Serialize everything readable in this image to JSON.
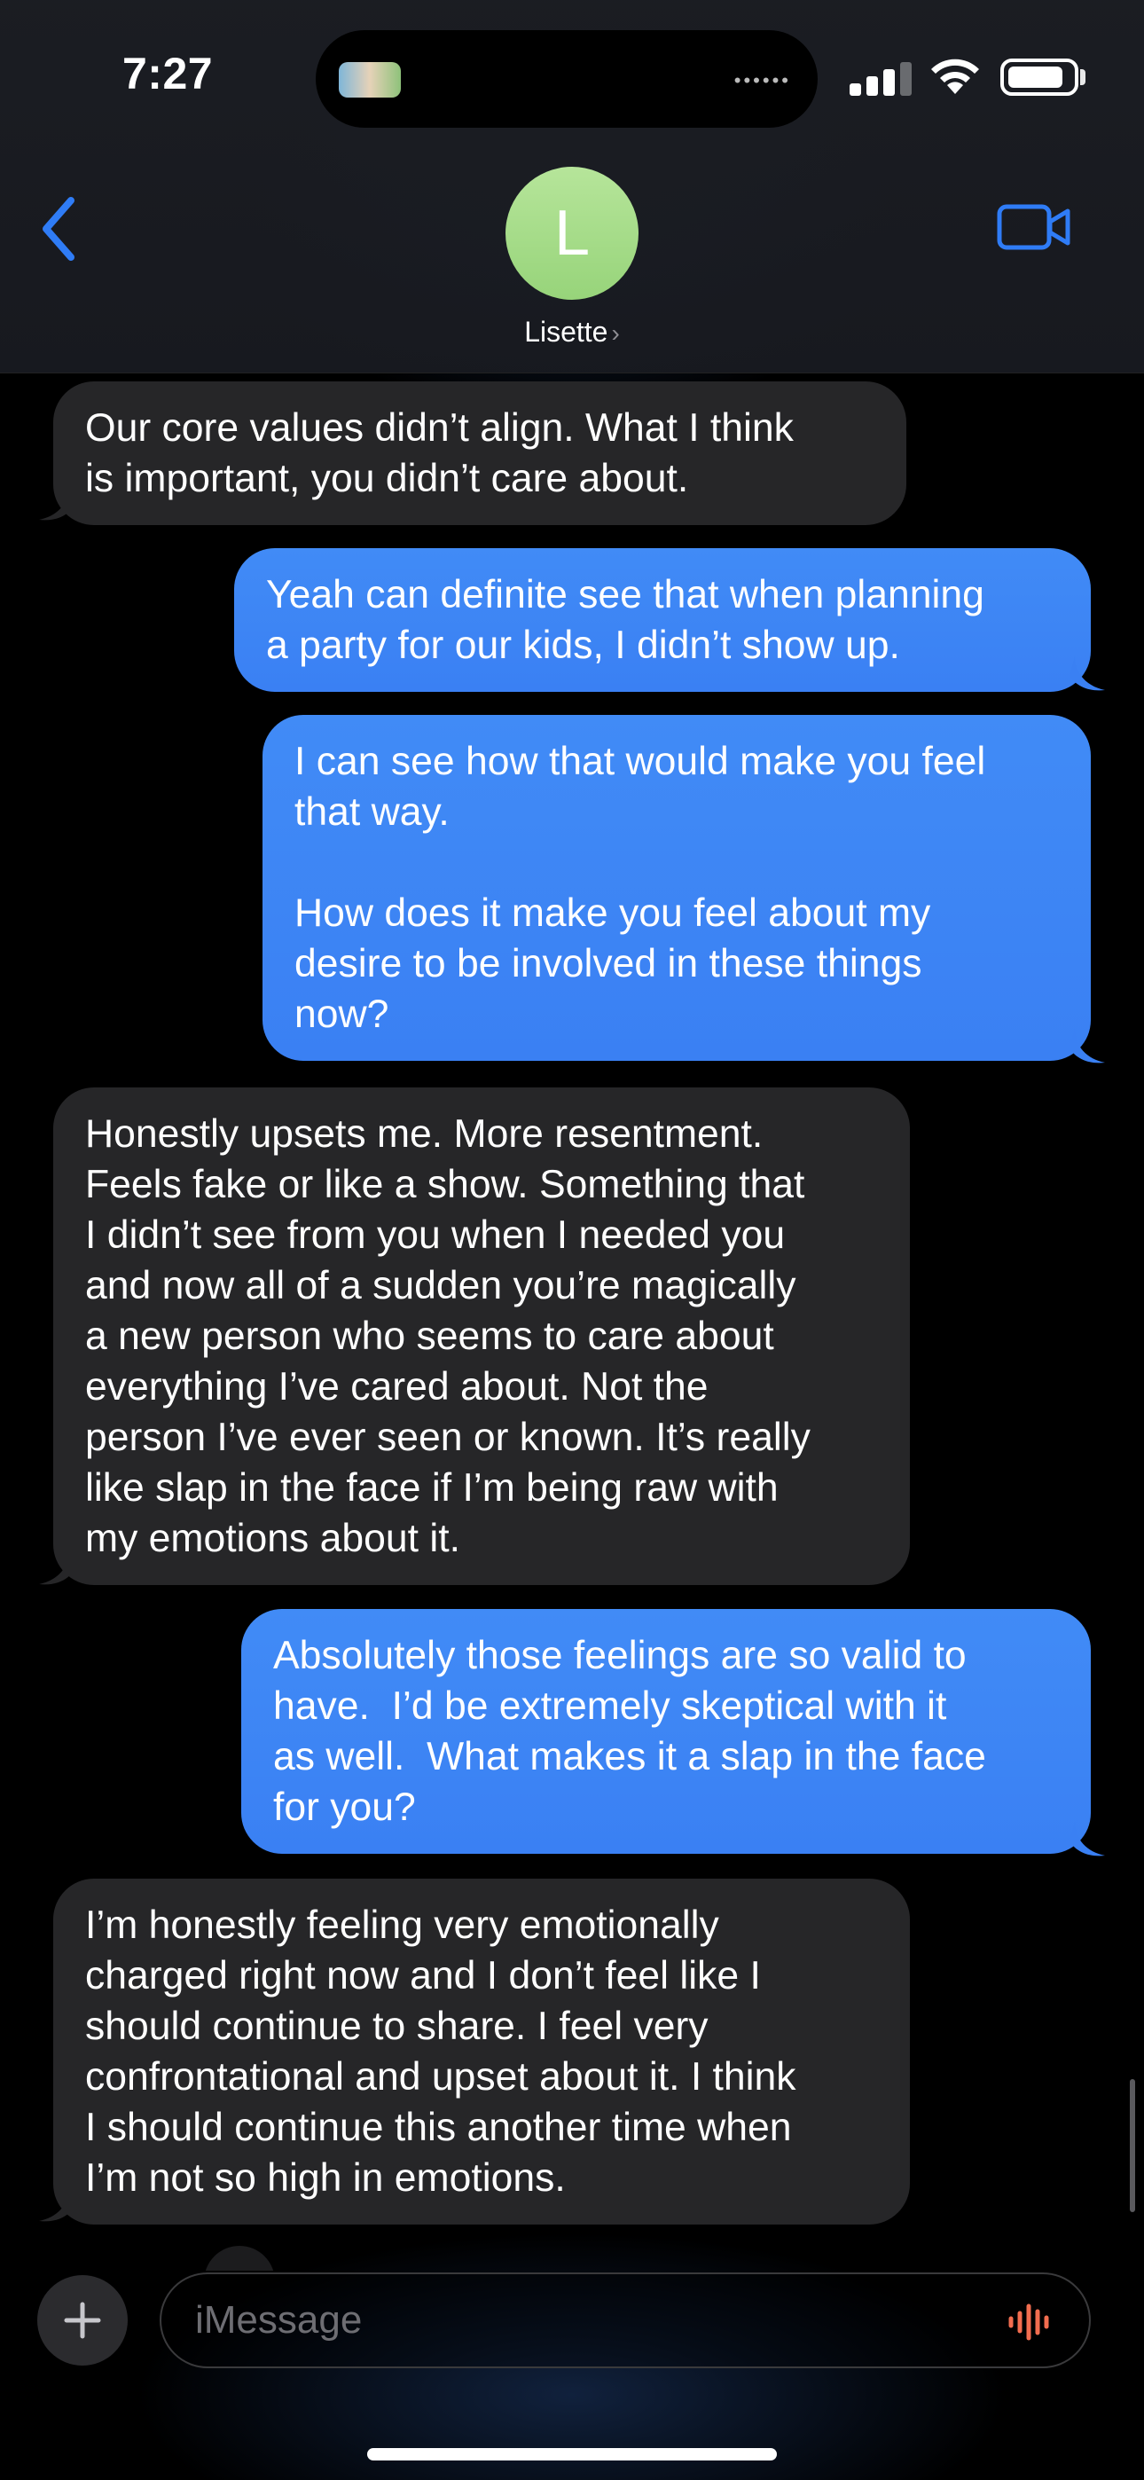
{
  "status_bar": {
    "time": "7:27"
  },
  "header": {
    "contact_name": "Lisette",
    "avatar_initial": "L"
  },
  "messages": [
    {
      "direction": "received",
      "text": "Our core values didn’t align. What I think\nis important, you didn’t care about."
    },
    {
      "direction": "sent",
      "text": "Yeah can definite see that when planning\na party for our kids, I didn’t show up."
    },
    {
      "direction": "sent",
      "text": "I can see how that would make you feel\nthat way.\n\nHow does it make you feel about my\ndesire to be involved in these things\nnow?"
    },
    {
      "direction": "received",
      "text": "Honestly upsets me. More resentment.\nFeels fake or like a show. Something that\nI didn’t see from you when I needed you\nand now all of a sudden you’re magically\na new person who seems to care about\neverything I’ve cared about. Not the\nperson I’ve ever seen or known. It’s really\nlike slap in the face if I’m being raw with\nmy emotions about it."
    },
    {
      "direction": "sent",
      "text": "Absolutely those feelings are so valid to\nhave.  I’d be extremely skeptical with it\nas well.  What makes it a slap in the face\nfor you?"
    },
    {
      "direction": "received",
      "text": "I’m honestly feeling very emotionally\ncharged right now and I don’t feel like I\nshould continue to share. I feel very\nconfrontational and upset about it. I think\nI should continue this another time when\nI’m not so high in emotions."
    }
  ],
  "composer": {
    "placeholder": "iMessage"
  },
  "colors": {
    "sent_bubble": "#3b82f6",
    "received_bubble": "#262628",
    "accent": "#2f7cf6",
    "audio_icon": "#f26d4f"
  }
}
